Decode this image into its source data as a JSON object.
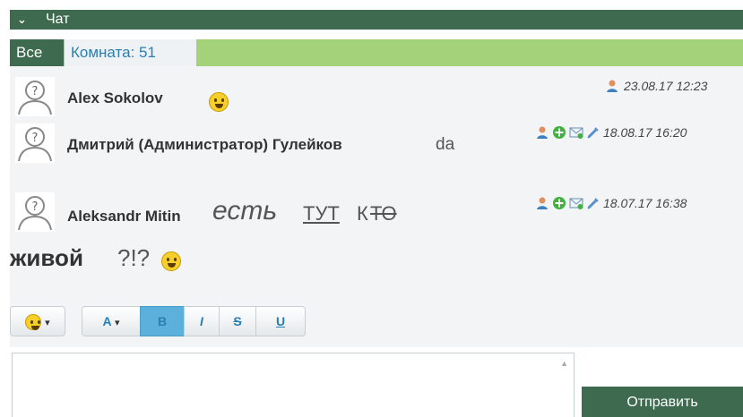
{
  "header": {
    "title": "Чат"
  },
  "tabs": [
    {
      "label": "Все"
    },
    {
      "label": "Комната: 51"
    }
  ],
  "messages": [
    {
      "author": "Alex Sokolov",
      "text": "",
      "timestamp": "23.08.17 12:23"
    },
    {
      "author": "Дмитрий (Администратор) Гулейков",
      "text": "da",
      "timestamp": "18.08.17 16:20"
    },
    {
      "author": "Aleksandr Mitin",
      "text_italic": "есть",
      "text_underline": "ТУТ",
      "text_normal": "К",
      "text_strike": "ТО",
      "text_bold": "живой",
      "text_end": "?!?",
      "timestamp": "18.07.17 16:38"
    }
  ],
  "toolbar": {
    "emoji_caret": "▾",
    "color_label": "A",
    "color_caret": "▾",
    "bold": "B",
    "italic": "I",
    "strike": "S",
    "underline": "U"
  },
  "composer": {
    "placeholder": "",
    "send_label": "Отправить"
  },
  "colors": {
    "dark_green": "#3e6b4f",
    "light_green": "#a3d27a",
    "link_blue": "#2a7fb1",
    "active_blue": "#5bb0dc"
  },
  "icons": [
    "chevron-down-icon",
    "user-avatar-icon",
    "smiley-icon",
    "user-icon",
    "add-icon",
    "mail-icon",
    "plug-icon"
  ]
}
